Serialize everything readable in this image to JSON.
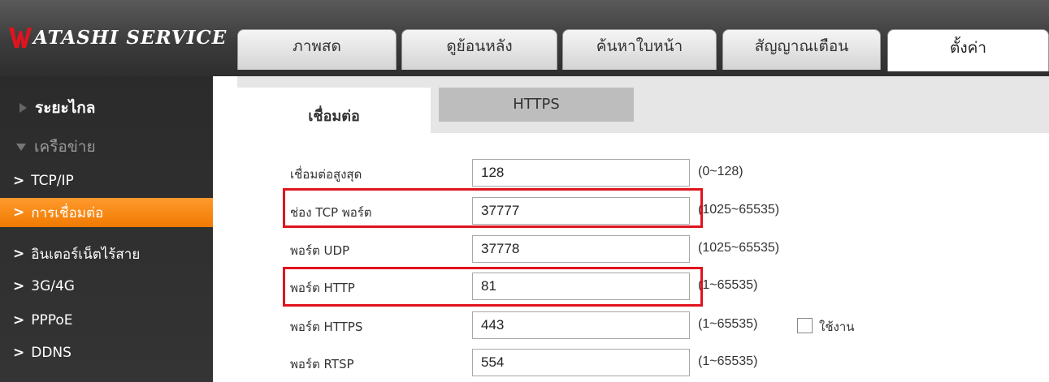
{
  "brand": {
    "logo_text": "ATASHI SERVICE",
    "logo_letter": "W",
    "accent": "#e0141e"
  },
  "top_tabs": [
    {
      "label": "ภาพสด",
      "active": false
    },
    {
      "label": "ดูย้อนหลัง",
      "active": false
    },
    {
      "label": "ค้นหาใบหน้า",
      "active": false
    },
    {
      "label": "สัญญาณเตือน",
      "active": false
    },
    {
      "label": "ตั้งค่า",
      "active": true
    }
  ],
  "sidebar": {
    "groups": [
      {
        "label": "ระยะไกล",
        "expanded": false
      },
      {
        "label": "เครือข่าย",
        "expanded": true
      }
    ],
    "items": [
      {
        "label": "TCP/IP",
        "active": false
      },
      {
        "label": "การเชื่อมต่อ",
        "active": true
      },
      {
        "label": "อินเตอร์เน็ตไร้สาย",
        "active": false
      },
      {
        "label": "3G/4G",
        "active": false
      },
      {
        "label": "PPPoE",
        "active": false
      },
      {
        "label": "DDNS",
        "active": false
      }
    ],
    "active_color": "#f5880f"
  },
  "subtabs": [
    {
      "label": "เชื่อมต่อ",
      "active": true
    },
    {
      "label": "HTTPS",
      "active": false
    }
  ],
  "form": {
    "rows": [
      {
        "label": "เชื่อมต่อสูงสุด",
        "value": "128",
        "range": "(0~128)"
      },
      {
        "label": "ช่อง TCP พอร์ต",
        "value": "37777",
        "range": "(1025~65535)",
        "highlighted": true
      },
      {
        "label": "พอร์ต UDP",
        "value": "37778",
        "range": "(1025~65535)"
      },
      {
        "label": "พอร์ต HTTP",
        "value": "81",
        "range": "(1~65535)",
        "highlighted": true
      },
      {
        "label": "พอร์ต HTTPS",
        "value": "443",
        "range": "(1~65535)",
        "checkbox_label": "ใช้งาน",
        "checked": false
      },
      {
        "label": "พอร์ต RTSP",
        "value": "554",
        "range": "(1~65535)"
      }
    ]
  }
}
